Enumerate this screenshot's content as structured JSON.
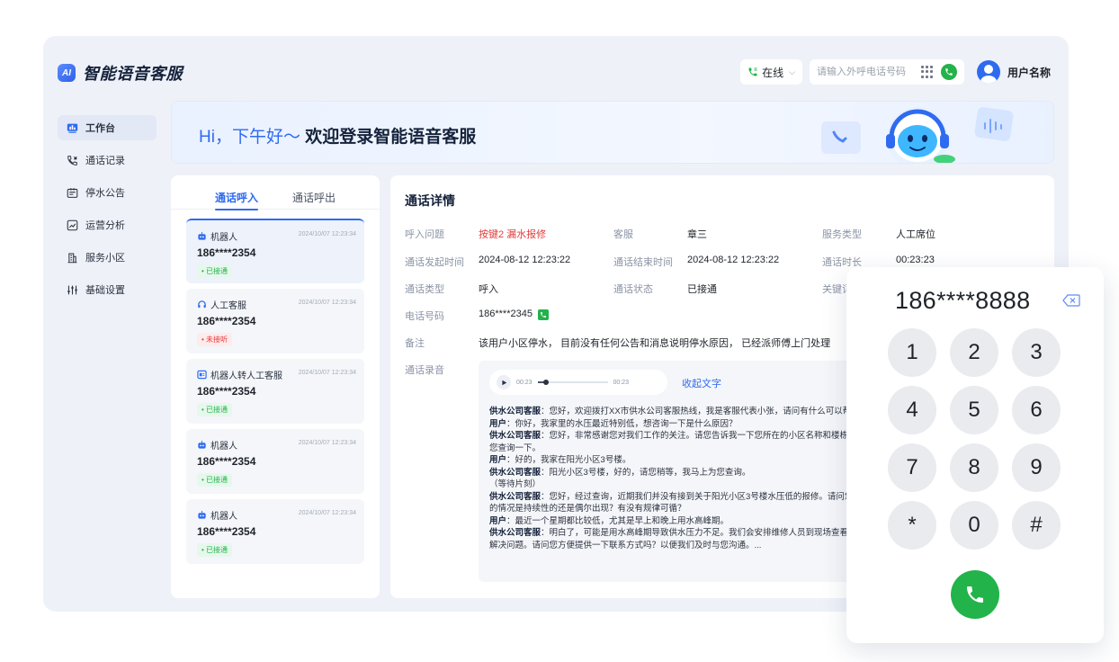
{
  "app": {
    "logo_badge": "AI",
    "title": "智能语音客服"
  },
  "header": {
    "status": "在线",
    "dial_placeholder": "请输入外呼电话号码",
    "user_name": "用户名称"
  },
  "sidebar": {
    "items": [
      {
        "label": "工作台",
        "icon": "dashboard-icon",
        "active": true
      },
      {
        "label": "通话记录",
        "icon": "call-log-icon"
      },
      {
        "label": "停水公告",
        "icon": "announcement-icon"
      },
      {
        "label": "运营分析",
        "icon": "analytics-icon"
      },
      {
        "label": "服务小区",
        "icon": "building-icon"
      },
      {
        "label": "基础设置",
        "icon": "settings-icon"
      }
    ]
  },
  "banner": {
    "greeting": "Hi，下午好～",
    "title": "欢迎登录智能语音客服"
  },
  "call_list": {
    "tabs": [
      "通话呼入",
      "通话呼出"
    ],
    "items": [
      {
        "type": "机器人",
        "icon": "robot-icon",
        "time": "2024/10/07 12:23:34",
        "phone": "186****2354",
        "status": "已接通",
        "status_kind": "ok"
      },
      {
        "type": "人工客服",
        "icon": "headset-icon",
        "time": "2024/10/07 12:23:34",
        "phone": "186****2354",
        "status": "未接听",
        "status_kind": "miss"
      },
      {
        "type": "机器人转人工客服",
        "icon": "transfer-icon",
        "time": "2024/10/07 12:23:34",
        "phone": "186****2354",
        "status": "已接通",
        "status_kind": "ok"
      },
      {
        "type": "机器人",
        "icon": "robot-icon",
        "time": "2024/10/07 12:23:34",
        "phone": "186****2354",
        "status": "已接通",
        "status_kind": "ok"
      },
      {
        "type": "机器人",
        "icon": "robot-icon",
        "time": "2024/10/07 12:23:34",
        "phone": "186****2354",
        "status": "已接通",
        "status_kind": "ok"
      }
    ]
  },
  "details": {
    "title": "通话详情",
    "inquiry_label": "呼入问题",
    "inquiry_value": "按键2 漏水报修",
    "agent_label": "客服",
    "agent_value": "章三",
    "service_type_label": "服务类型",
    "service_type_value": "人工席位",
    "start_label": "通话发起时间",
    "start_value": "2024-08-12 12:23:22",
    "end_label": "通话结束时间",
    "end_value": "2024-08-12 12:23:22",
    "duration_label": "通话时长",
    "duration_value": "00:23:23",
    "call_type_label": "通话类型",
    "call_type_value": "呼入",
    "call_status_label": "通话状态",
    "call_status_value": "已接通",
    "keyword_label": "关键词",
    "phone_label": "电话号码",
    "phone_value": "186****2345",
    "remark_label": "备注",
    "remark_value": "该用户小区停水， 目前没有任何公告和消息说明停水原因， 已经派师傅上门处理",
    "recording_label": "通话录音",
    "player": {
      "current": "00:23",
      "total": "00:23",
      "progress": 0.12
    },
    "collapse_label": "收起文字",
    "transcript": [
      {
        "speaker": "供水公司客服",
        "text": "您好，欢迎拨打XX市供水公司客服热线，我是客服代表小张，请问有什么可以帮您？"
      },
      {
        "speaker": "用户",
        "text": "你好，我家里的水压最近特别低，想咨询一下是什么原因？"
      },
      {
        "speaker": "供水公司客服",
        "text": "您好，非常感谢您对我们工作的关注。请您告诉我一下您所在的小区名称和楼栋号，我帮"
      },
      {
        "speaker": "",
        "text": "您查询一下。"
      },
      {
        "speaker": "用户",
        "text": "好的，我家在阳光小区3号楼。"
      },
      {
        "speaker": "供水公司客服",
        "text": "阳光小区3号楼，好的，请您稍等，我马上为您查询。"
      },
      {
        "speaker": "",
        "text": "（等待片刻）"
      },
      {
        "speaker": "供水公司客服",
        "text": "您好，经过查询，近期我们并没有接到关于阳光小区3号楼水压低的报修。请问您家水压低"
      },
      {
        "speaker": "",
        "text": "的情况是持续性的还是偶尔出现？有没有规律可循？"
      },
      {
        "speaker": "用户",
        "text": "最近一个星期都比较低，尤其是早上和晚上用水高峰期。"
      },
      {
        "speaker": "供水公司客服",
        "text": "明白了，可能是用水高峰期导致供水压力不足。我们会安排维修人员到现场查看，尽快为您"
      },
      {
        "speaker": "",
        "text": "解决问题。请问您方便提供一下联系方式吗？以便我们及时与您沟通。..."
      }
    ]
  },
  "dialpad": {
    "number": "186****8888",
    "keys": [
      "1",
      "2",
      "3",
      "4",
      "5",
      "6",
      "7",
      "8",
      "9",
      "*",
      "0",
      "#"
    ]
  },
  "colors": {
    "accent": "#2f6bf0",
    "success": "#22b34a",
    "danger": "#e53b3b",
    "background": "#eef1f8"
  }
}
